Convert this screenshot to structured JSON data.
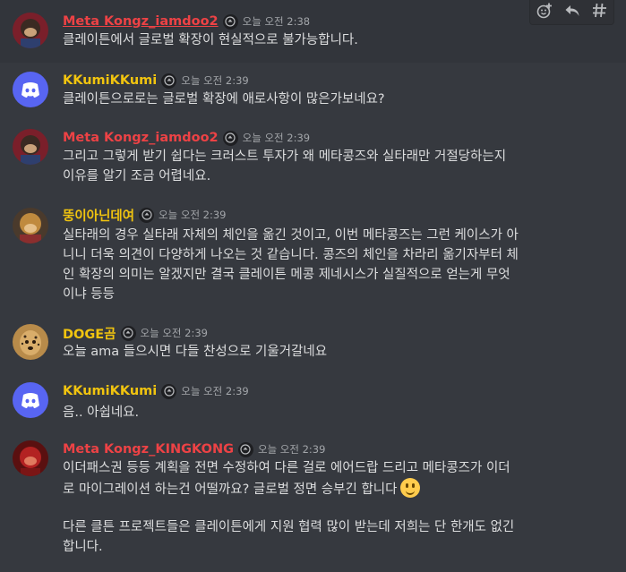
{
  "colors": {
    "background": "#36393f",
    "username_red": "#ed4245",
    "username_yellow": "#f1c40f",
    "discord_blurple": "#5865f2"
  },
  "toolbar": {
    "icons": [
      "add-reaction-icon",
      "reply-icon",
      "thread-icon"
    ]
  },
  "messages": [
    {
      "author": "Meta Kongz_iamdoo2",
      "timestamp": "오늘 오전 2:38",
      "text": "클레이튼에서 글로벌 확장이 현실적으로 불가능합니다."
    },
    {
      "author": "KKumiKKumi",
      "timestamp": "오늘 오전 2:39",
      "text": "클레이튼으로로는 글로벌 확장에 애로사항이 많은가보네요?"
    },
    {
      "author": "Meta Kongz_iamdoo2",
      "timestamp": "오늘 오전 2:39",
      "text": "그리고 그렇게 받기 쉽다는 크러스트 투자가 왜 메타콩즈와 실타래만 거절당하는지\n이유를 알기 조금 어렵네요."
    },
    {
      "author": "뚱이아닌데여",
      "timestamp": "오늘 오전 2:39",
      "text": "실타래의 경우 실타래 자체의 체인을 옮긴 것이고, 이번 메타콩즈는 그런 케이스가 아\n니니 더욱 의견이 다양하게 나오는 것 같습니다. 콩즈의 체인을 차라리 옮기자부터 체\n인 확장의 의미는 알겠지만 결국 클레이튼 메콩 제네시스가 실질적으로 얻는게 무엇\n이냐 등등"
    },
    {
      "author": "DOGE곰",
      "timestamp": "오늘 오전 2:39",
      "text": "오늘 ama 들으시면 다들 찬성으로 기울거갈네요"
    },
    {
      "author": "KKumiKKumi",
      "timestamp": "오늘 오전 2:39",
      "text": "음.. 아쉽네요."
    },
    {
      "author": "Meta Kongz_KINGKONG",
      "timestamp": "오늘 오전 2:39",
      "text": "이더패스권 등등 계획을 전면 수정하여 다른 걸로 에어드랍 드리고 메타콩즈가 이더\n로 마이그레이션 하는건 어떨까요? 글로벌 정면 승부긴 합니다",
      "text2": "다른 클튼 프로젝트들은 클레이튼에게 지원 협력 많이 받는데 저희는 단 한개도 없긴\n합니다."
    }
  ]
}
